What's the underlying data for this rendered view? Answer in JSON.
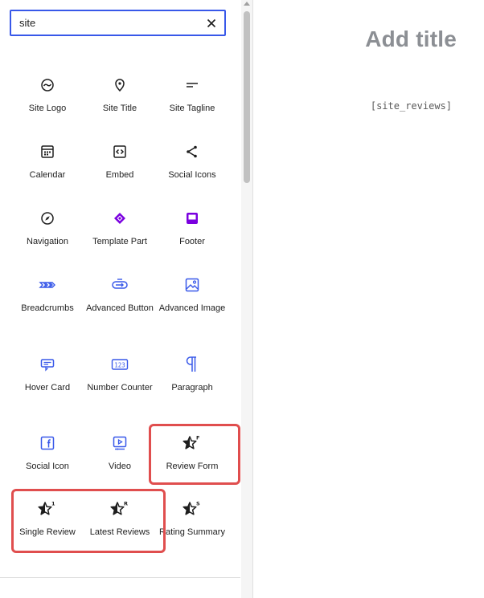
{
  "search": {
    "value": "site",
    "placeholder": "Search"
  },
  "blocks": [
    {
      "label": "Site Logo",
      "icon": "site-logo-icon"
    },
    {
      "label": "Site Title",
      "icon": "map-pin-icon"
    },
    {
      "label": "Site Tagline",
      "icon": "tagline-icon"
    },
    {
      "label": "Calendar",
      "icon": "calendar-icon"
    },
    {
      "label": "Embed",
      "icon": "embed-icon"
    },
    {
      "label": "Social Icons",
      "icon": "share-icon"
    },
    {
      "label": "Navigation",
      "icon": "compass-icon"
    },
    {
      "label": "Template Part",
      "icon": "diamond-icon"
    },
    {
      "label": "Footer",
      "icon": "footer-icon"
    },
    {
      "label": "Breadcrumbs",
      "icon": "breadcrumbs-icon"
    },
    {
      "label": "Advanced Button",
      "icon": "button-icon"
    },
    {
      "label": "Advanced Image",
      "icon": "image-icon"
    },
    {
      "label": "Hover Card",
      "icon": "hover-card-icon"
    },
    {
      "label": "Number Counter",
      "icon": "counter-icon"
    },
    {
      "label": "Paragraph",
      "icon": "pilcrow-icon"
    },
    {
      "label": "Social Icon",
      "icon": "facebook-icon"
    },
    {
      "label": "Video",
      "icon": "video-icon"
    },
    {
      "label": "Review Form",
      "icon": "star-f-icon",
      "badge": "F"
    },
    {
      "label": "Single Review",
      "icon": "star-1-icon",
      "badge": "1"
    },
    {
      "label": "Latest Reviews",
      "icon": "star-r-icon",
      "badge": "R"
    },
    {
      "label": "Rating Summary",
      "icon": "star-s-icon",
      "badge": "S"
    }
  ],
  "editor": {
    "title": "Add title",
    "shortcode": "[site_reviews]"
  },
  "colors": {
    "accent": "#3858e9",
    "purple": "#7a00df",
    "highlight": "#e04e4e",
    "title": "#8c8f94"
  }
}
